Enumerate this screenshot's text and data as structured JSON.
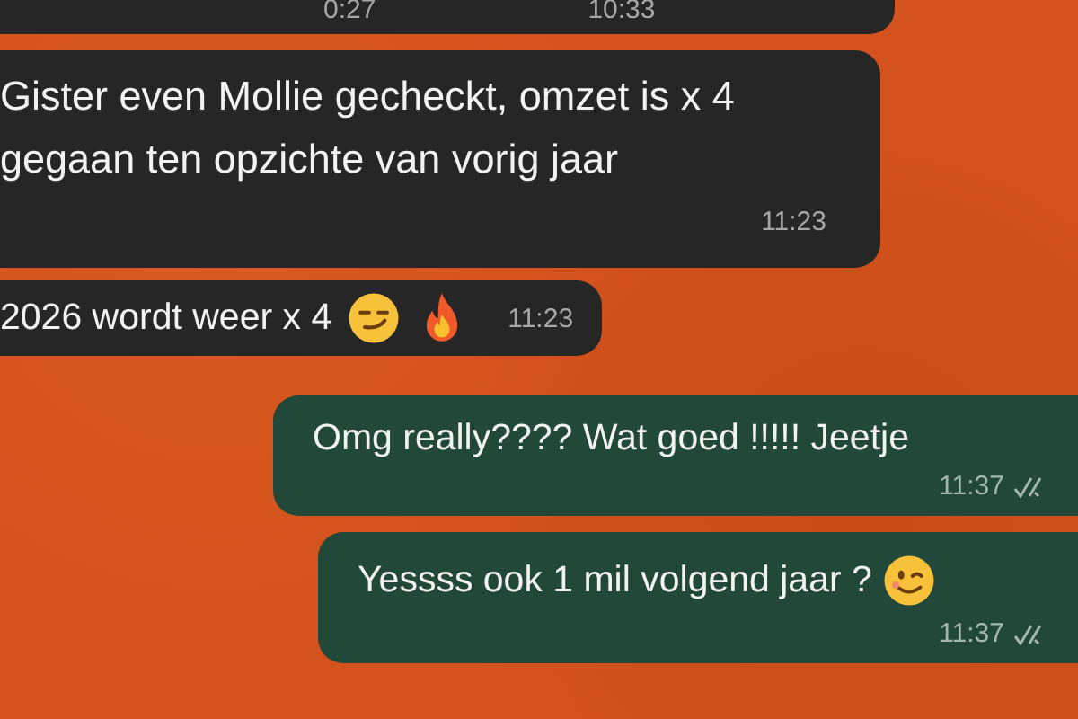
{
  "messages": [
    {
      "kind": "incoming",
      "times": [
        "0:27",
        "10:33"
      ]
    },
    {
      "kind": "incoming",
      "text": "Gister even Mollie gecheckt, omzet is x 4 gegaan ten opzichte van vorig jaar",
      "time": "11:23"
    },
    {
      "kind": "incoming",
      "text": "2026 wordt weer x 4",
      "time": "11:23",
      "icons": [
        {
          "kind": "smirk"
        },
        {
          "kind": "fire"
        }
      ]
    },
    {
      "kind": "outgoing",
      "text": "Omg really???? Wat goed !!!!! Jeetje",
      "time": "11:37",
      "read": true
    },
    {
      "kind": "outgoing",
      "text": "Yessss ook 1 mil volgend jaar ?",
      "time": "11:37",
      "read": true,
      "icons": [
        {
          "kind": "wink"
        }
      ]
    }
  ]
}
